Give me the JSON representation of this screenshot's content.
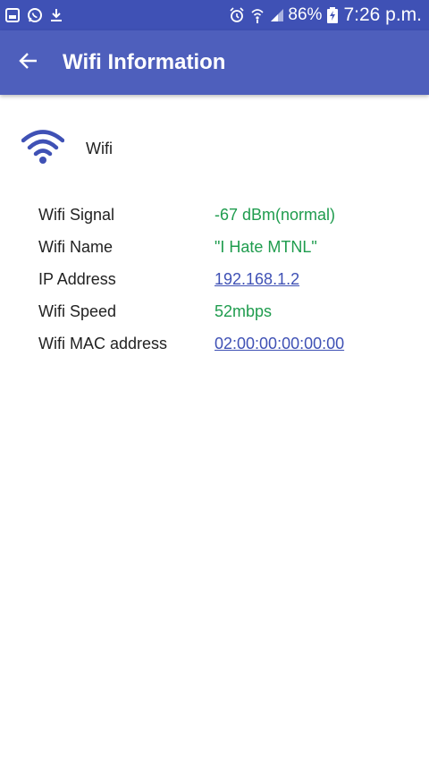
{
  "status_bar": {
    "battery": "86%",
    "time": "7:26 p.m.",
    "icons_left": [
      "gallery-icon",
      "whatsapp-icon",
      "download-icon"
    ],
    "icons_right": [
      "alarm-icon",
      "wifi-status-icon",
      "signal-icon",
      "battery-charging-icon"
    ]
  },
  "app_bar": {
    "title": "Wifi Information",
    "back_icon": "back-arrow-icon"
  },
  "wifi_header": {
    "label": "Wifi",
    "icon": "wifi-icon"
  },
  "details": [
    {
      "key": "Wifi Signal",
      "value": "-67 dBm(normal)",
      "link": false
    },
    {
      "key": "Wifi Name",
      "value": "\"I Hate MTNL\"",
      "link": false
    },
    {
      "key": "IP Address",
      "value": "192.168.1.2",
      "link": true
    },
    {
      "key": "Wifi Speed",
      "value": "52mbps",
      "link": false
    },
    {
      "key": "Wifi MAC address",
      "value": "02:00:00:00:00:00",
      "link": true
    }
  ],
  "colors": {
    "primary": "#4e5fbc",
    "status_bar": "#3f51b5",
    "value_green": "#1f9c4e",
    "link_blue": "#3f51b5"
  }
}
